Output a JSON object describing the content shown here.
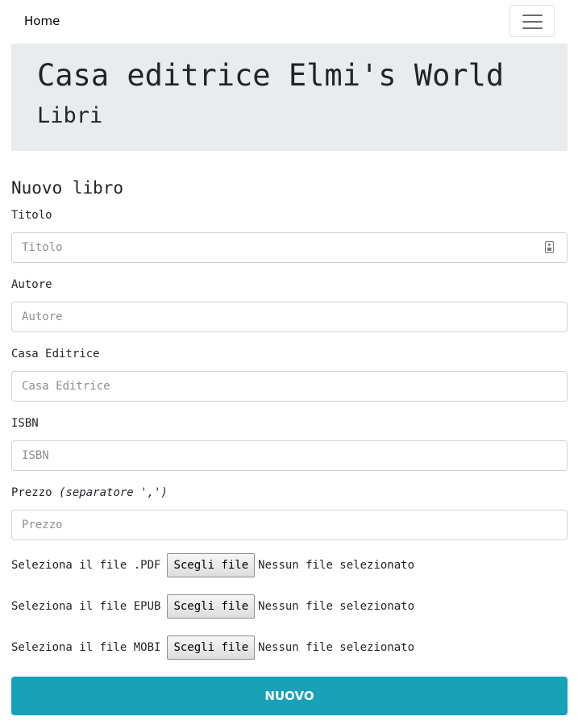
{
  "navbar": {
    "home_label": "Home"
  },
  "jumbotron": {
    "title": "Casa editrice Elmi's World",
    "subtitle": "Libri"
  },
  "form": {
    "title": "Nuovo libro",
    "fields": {
      "titolo": {
        "label": "Titolo",
        "placeholder": "Titolo",
        "value": ""
      },
      "autore": {
        "label": "Autore",
        "placeholder": "Autore",
        "value": ""
      },
      "casa_editrice": {
        "label": "Casa Editrice",
        "placeholder": "Casa Editrice",
        "value": ""
      },
      "isbn": {
        "label": "ISBN",
        "placeholder": "ISBN",
        "value": ""
      },
      "prezzo": {
        "label": "Prezzo",
        "hint": "(separatore ',')",
        "placeholder": "Prezzo",
        "value": ""
      }
    },
    "files": {
      "pdf": {
        "label": "Seleziona il file .PDF",
        "button": "Scegli file",
        "status": "Nessun file selezionato"
      },
      "epub": {
        "label": "Seleziona il file EPUB",
        "button": "Scegli file",
        "status": "Nessun file selezionato"
      },
      "mobi": {
        "label": "Seleziona il file MOBI",
        "button": "Scegli file",
        "status": "Nessun file selezionato"
      }
    },
    "submit_label": "NUOVO"
  },
  "icons": {
    "navbar_toggler": "hamburger-icon",
    "titolo_input": "contact-card-icon"
  },
  "colors": {
    "jumbotron_bg": "#e9ecef",
    "submit_bg": "#17a2b8"
  }
}
